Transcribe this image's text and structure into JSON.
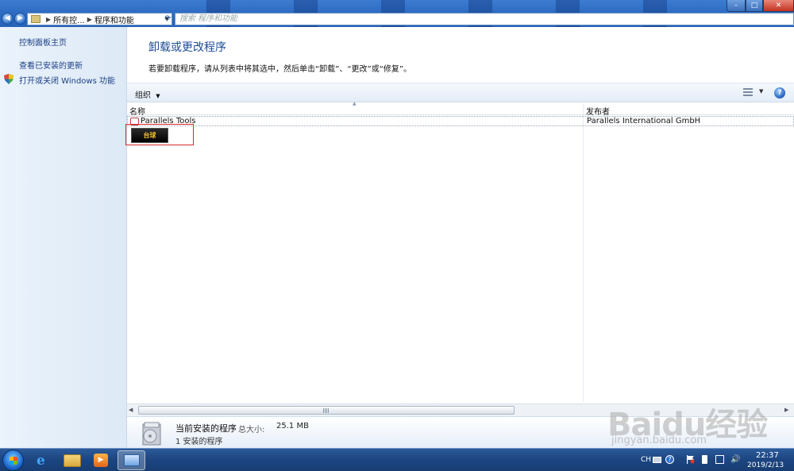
{
  "address_bar": {
    "crumb1": "所有控...",
    "crumb2": "程序和功能",
    "search_placeholder": "搜索 程序和功能"
  },
  "sidebar": {
    "items": [
      {
        "label": "控制面板主页"
      },
      {
        "label": "查看已安装的更新"
      },
      {
        "label": "打开或关闭 Windows 功能"
      }
    ]
  },
  "main": {
    "title": "卸载或更改程序",
    "description": "若要卸载程序，请从列表中将其选中，然后单击“卸载”、“更改”或“修复”。",
    "organize_label": "组织",
    "columns": {
      "name": "名称",
      "publisher": "发布者"
    },
    "programs": [
      {
        "name": "Parallels Tools",
        "publisher": "Parallels International GmbH"
      },
      {
        "name": "",
        "publisher": "",
        "logo_text": "台球"
      }
    ]
  },
  "details": {
    "title": "当前安装的程序",
    "size_label": "总大小:",
    "size_value": "25.1 MB",
    "count_text": "1 安装的程序"
  },
  "taskbar": {
    "lang": "CH",
    "time": "22:37",
    "date": "2019/2/13"
  },
  "watermark": {
    "logo": "Baidu经验",
    "url": "jingyan.baidu.com"
  },
  "colors": {
    "title_blue": "#1c4c96",
    "link_blue": "#1c3f84",
    "highlight_red": "#d92b2b",
    "taskbar": "#1c4580"
  },
  "icons": {
    "back": "back-arrow-icon",
    "forward": "forward-arrow-icon",
    "refresh": "refresh-icon",
    "help": "help-icon",
    "shield": "uac-shield-icon"
  }
}
